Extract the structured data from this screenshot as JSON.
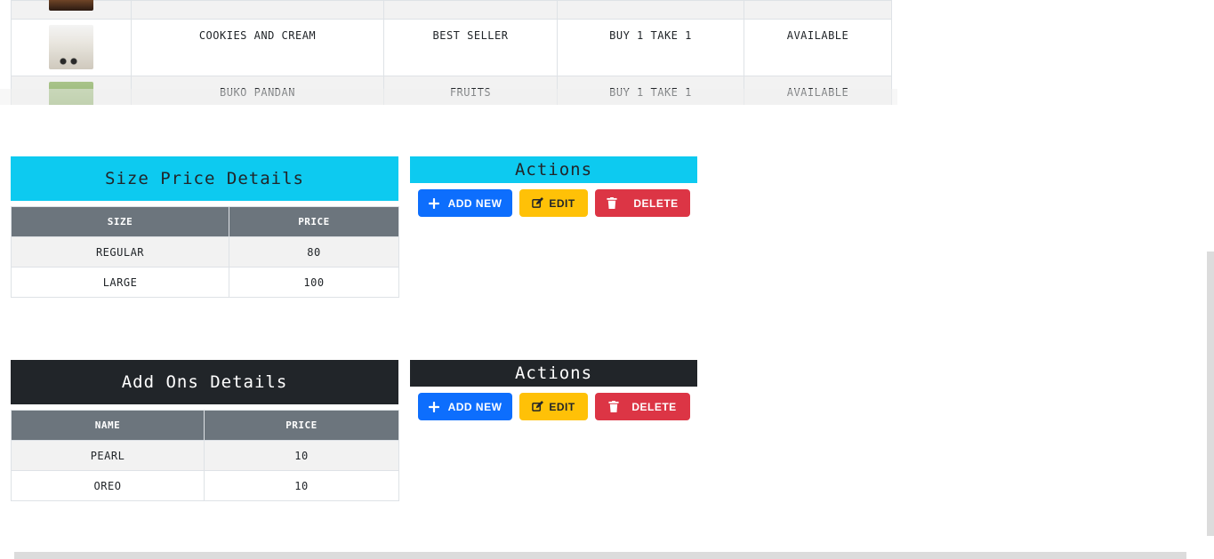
{
  "products": {
    "rows": [
      {
        "name": "",
        "category": "",
        "promo": "",
        "status": "",
        "image": "dark-drink-image"
      },
      {
        "name": "COOKIES AND CREAM",
        "category": "BEST SELLER",
        "promo": "BUY 1 TAKE 1",
        "status": "AVAILABLE",
        "image": "cookies-and-cream-drink-image"
      },
      {
        "name": "BUKO PANDAN",
        "category": "FRUITS",
        "promo": "BUY 1 TAKE 1",
        "status": "AVAILABLE",
        "image": "buko-pandan-drink-image"
      }
    ]
  },
  "size_section": {
    "title": "Size Price Details",
    "actions_title": "Actions",
    "columns": [
      "SIZE",
      "PRICE"
    ],
    "rows": [
      {
        "size": "REGULAR",
        "price": "80"
      },
      {
        "size": "LARGE",
        "price": "100"
      }
    ],
    "buttons": {
      "add": "ADD NEW",
      "edit": "EDIT",
      "delete": "DELETE"
    },
    "header_color": "#0dcaf0"
  },
  "addons_section": {
    "title": "Add Ons Details",
    "actions_title": "Actions",
    "columns": [
      "NAME",
      "PRICE"
    ],
    "rows": [
      {
        "name": "PEARL",
        "price": "10"
      },
      {
        "name": "OREO",
        "price": "10"
      }
    ],
    "buttons": {
      "add": "ADD NEW",
      "edit": "EDIT",
      "delete": "DELETE"
    },
    "header_color": "#212529"
  },
  "colors": {
    "primary": "#0d6efd",
    "warning": "#ffc107",
    "danger": "#dc3545",
    "table_header": "#6c757d"
  },
  "icons": {
    "add": "plus-icon",
    "edit": "edit-icon",
    "delete": "trash-icon"
  }
}
